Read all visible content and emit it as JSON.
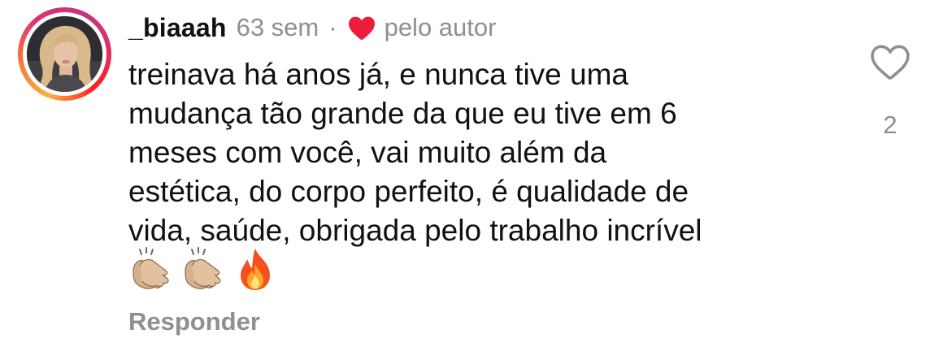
{
  "comment": {
    "username": "_biaaah",
    "time_ago": "63 sem",
    "separator": "·",
    "author_like_label": "pelo autor",
    "text_lines": [
      "treinava há anos já, e nunca tive uma",
      "mudança tão grande da que eu tive em 6",
      "meses com você, vai muito além da",
      "estética, do corpo perfeito, é qualidade de",
      "vida, saúde, obrigada pelo trabalho incrível"
    ],
    "emojis": [
      "clapping-hands",
      "clapping-hands",
      "fire"
    ],
    "reply_label": "Responder",
    "like_count": "2"
  },
  "icons": {
    "author_heart": "heart-filled-icon",
    "like": "heart-outline-icon"
  },
  "colors": {
    "author_heart": "#ed1c3a",
    "muted_text": "#8e8e93",
    "ring_gradient": [
      "#fcaf45",
      "#f77737",
      "#e1306c",
      "#c13584"
    ]
  }
}
